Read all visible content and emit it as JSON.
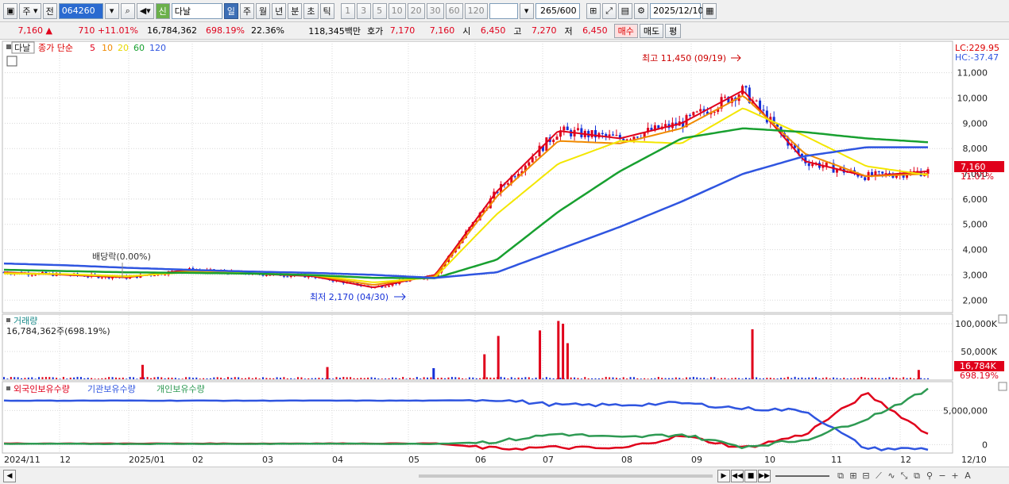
{
  "toolbar": {
    "market_label": "주",
    "prev_label": "전",
    "code": "064260",
    "name": "다날",
    "new_label": "신",
    "periods": [
      "일",
      "주",
      "월",
      "년",
      "분",
      "초",
      "틱"
    ],
    "active_period": "일",
    "intervals": [
      "1",
      "3",
      "5",
      "10",
      "20",
      "30",
      "60",
      "120"
    ],
    "count": "265",
    "count_total": "/600",
    "date": "2025/12/10"
  },
  "quote": {
    "price": "7,160",
    "arrow": "▲",
    "change": "710",
    "change_pct": "+11.01%",
    "volume": "16,784,362",
    "volume_ratio": "698.19%",
    "turnover_pct": "22.36%",
    "amount": "118,345백만",
    "bid_label": "호가",
    "ask_price": "7,170",
    "bid_price": "7,160",
    "open_label": "시",
    "open": "6,450",
    "high_label": "고",
    "high": "7,270",
    "low_label": "저",
    "low": "6,450",
    "buy_button": "매수",
    "sell_button": "매도",
    "eval_button": "평"
  },
  "price_panel": {
    "name_tag": "다날",
    "legend_prefix": "종가 단순",
    "ma_periods": [
      "5",
      "10",
      "20",
      "60",
      "120"
    ],
    "lc": "LC:229.95",
    "hc": "HC:-37.47",
    "last_price_tag": "7,160",
    "last_pct_tag": "11.01%",
    "annotation_high": "최고 11,450 (09/19)",
    "annotation_low": "최저 2,170 (04/30)",
    "annotation_dividend": "배당락(0.00%)"
  },
  "volume_panel": {
    "title": "거래량",
    "value": "16,784,362주(698.19%)",
    "last_tag": "16,784K",
    "last_pct_tag": "698.19%"
  },
  "holdings_panel": {
    "legend": [
      "외국인보유수량",
      "기관보유수량",
      "개인보유수량"
    ]
  },
  "x_axis": {
    "labels": [
      "2024/11",
      "12",
      "2025/01",
      "02",
      "03",
      "04",
      "05",
      "06",
      "07",
      "08",
      "09",
      "10",
      "11",
      "12",
      "12/10"
    ]
  },
  "colors": {
    "up": "#e0001b",
    "down": "#1530d8",
    "ma5": "#e0001b",
    "ma10": "#f08a00",
    "ma20": "#f3e600",
    "ma60": "#18a030",
    "ma120": "#2f55e0",
    "foreign": "#e0001b",
    "institution": "#2f55e0",
    "individual": "#2e9a53"
  },
  "chart_data": [
    {
      "type": "line",
      "title": "다날",
      "y_ticks": [
        "11,000",
        "10,000",
        "9,000",
        "8,000",
        "7,000",
        "6,000",
        "5,000",
        "4,000",
        "3,000",
        "2,000"
      ],
      "ylim": [
        1600,
        11900
      ],
      "x": [
        "2024/11",
        "12",
        "2025/01",
        "02",
        "03",
        "04",
        "05",
        "06",
        "07",
        "08",
        "09",
        "10",
        "11",
        "12",
        "12/10"
      ],
      "series": [
        {
          "name": "5",
          "values": [
            3100,
            3000,
            2900,
            3200,
            3050,
            2950,
            2500,
            3000,
            6300,
            8700,
            8400,
            9000,
            10300,
            7500,
            6900,
            7100
          ]
        },
        {
          "name": "10",
          "values": [
            3080,
            3020,
            2920,
            3150,
            3060,
            2980,
            2600,
            2950,
            6100,
            8300,
            8200,
            8800,
            10100,
            7800,
            6900,
            7000
          ]
        },
        {
          "name": "20",
          "values": [
            3050,
            3030,
            2950,
            3100,
            3070,
            3000,
            2700,
            2900,
            5400,
            7400,
            8300,
            8200,
            9600,
            8500,
            7300,
            6950
          ]
        },
        {
          "name": "60",
          "values": [
            3200,
            3150,
            3100,
            3080,
            3050,
            2990,
            2880,
            2870,
            3600,
            5500,
            7100,
            8400,
            8800,
            8650,
            8400,
            8250
          ]
        },
        {
          "name": "120",
          "values": [
            3450,
            3380,
            3280,
            3200,
            3130,
            3080,
            3000,
            2880,
            3100,
            4000,
            4900,
            5900,
            7000,
            7700,
            8050,
            8050
          ]
        }
      ],
      "annotations": {
        "high": 11450,
        "high_date": "09/19",
        "low": 2170,
        "low_date": "04/30"
      }
    },
    {
      "type": "bar",
      "title": "거래량",
      "y_ticks": [
        "100,000K",
        "50,000K"
      ],
      "ylim": [
        0,
        110000
      ],
      "unit": "K",
      "spikes": [
        {
          "x_frac": 0.15,
          "value": 26000,
          "up": true
        },
        {
          "x_frac": 0.35,
          "value": 22000,
          "up": true
        },
        {
          "x_frac": 0.465,
          "value": 20000,
          "up": false
        },
        {
          "x_frac": 0.52,
          "value": 45000,
          "up": true
        },
        {
          "x_frac": 0.535,
          "value": 78000,
          "up": true
        },
        {
          "x_frac": 0.58,
          "value": 88000,
          "up": true
        },
        {
          "x_frac": 0.6,
          "value": 105000,
          "up": true
        },
        {
          "x_frac": 0.605,
          "value": 100000,
          "up": true
        },
        {
          "x_frac": 0.61,
          "value": 65000,
          "up": true
        },
        {
          "x_frac": 0.81,
          "value": 90000,
          "up": true
        },
        {
          "x_frac": 0.99,
          "value": 16784,
          "up": true
        }
      ]
    },
    {
      "type": "line",
      "title": "보유수량",
      "y_ticks": [
        "5,000,000",
        "0"
      ],
      "series": [
        {
          "name": "외국인보유수량",
          "values": [
            150,
            160,
            150,
            160,
            150,
            170,
            160,
            180,
            -600,
            -400,
            -600,
            1300,
            -500,
            1500,
            7500,
            1600
          ]
        },
        {
          "name": "기관보유수량",
          "values": [
            6450,
            6450,
            6450,
            6450,
            6450,
            6450,
            6450,
            6450,
            6600,
            5800,
            5800,
            6100,
            5300,
            5000,
            -600,
            -600
          ]
        },
        {
          "name": "개인보유수량",
          "values": [
            120,
            120,
            110,
            120,
            110,
            140,
            130,
            110,
            450,
            1600,
            1000,
            1500,
            -300,
            700,
            3800,
            8000
          ]
        }
      ]
    }
  ]
}
